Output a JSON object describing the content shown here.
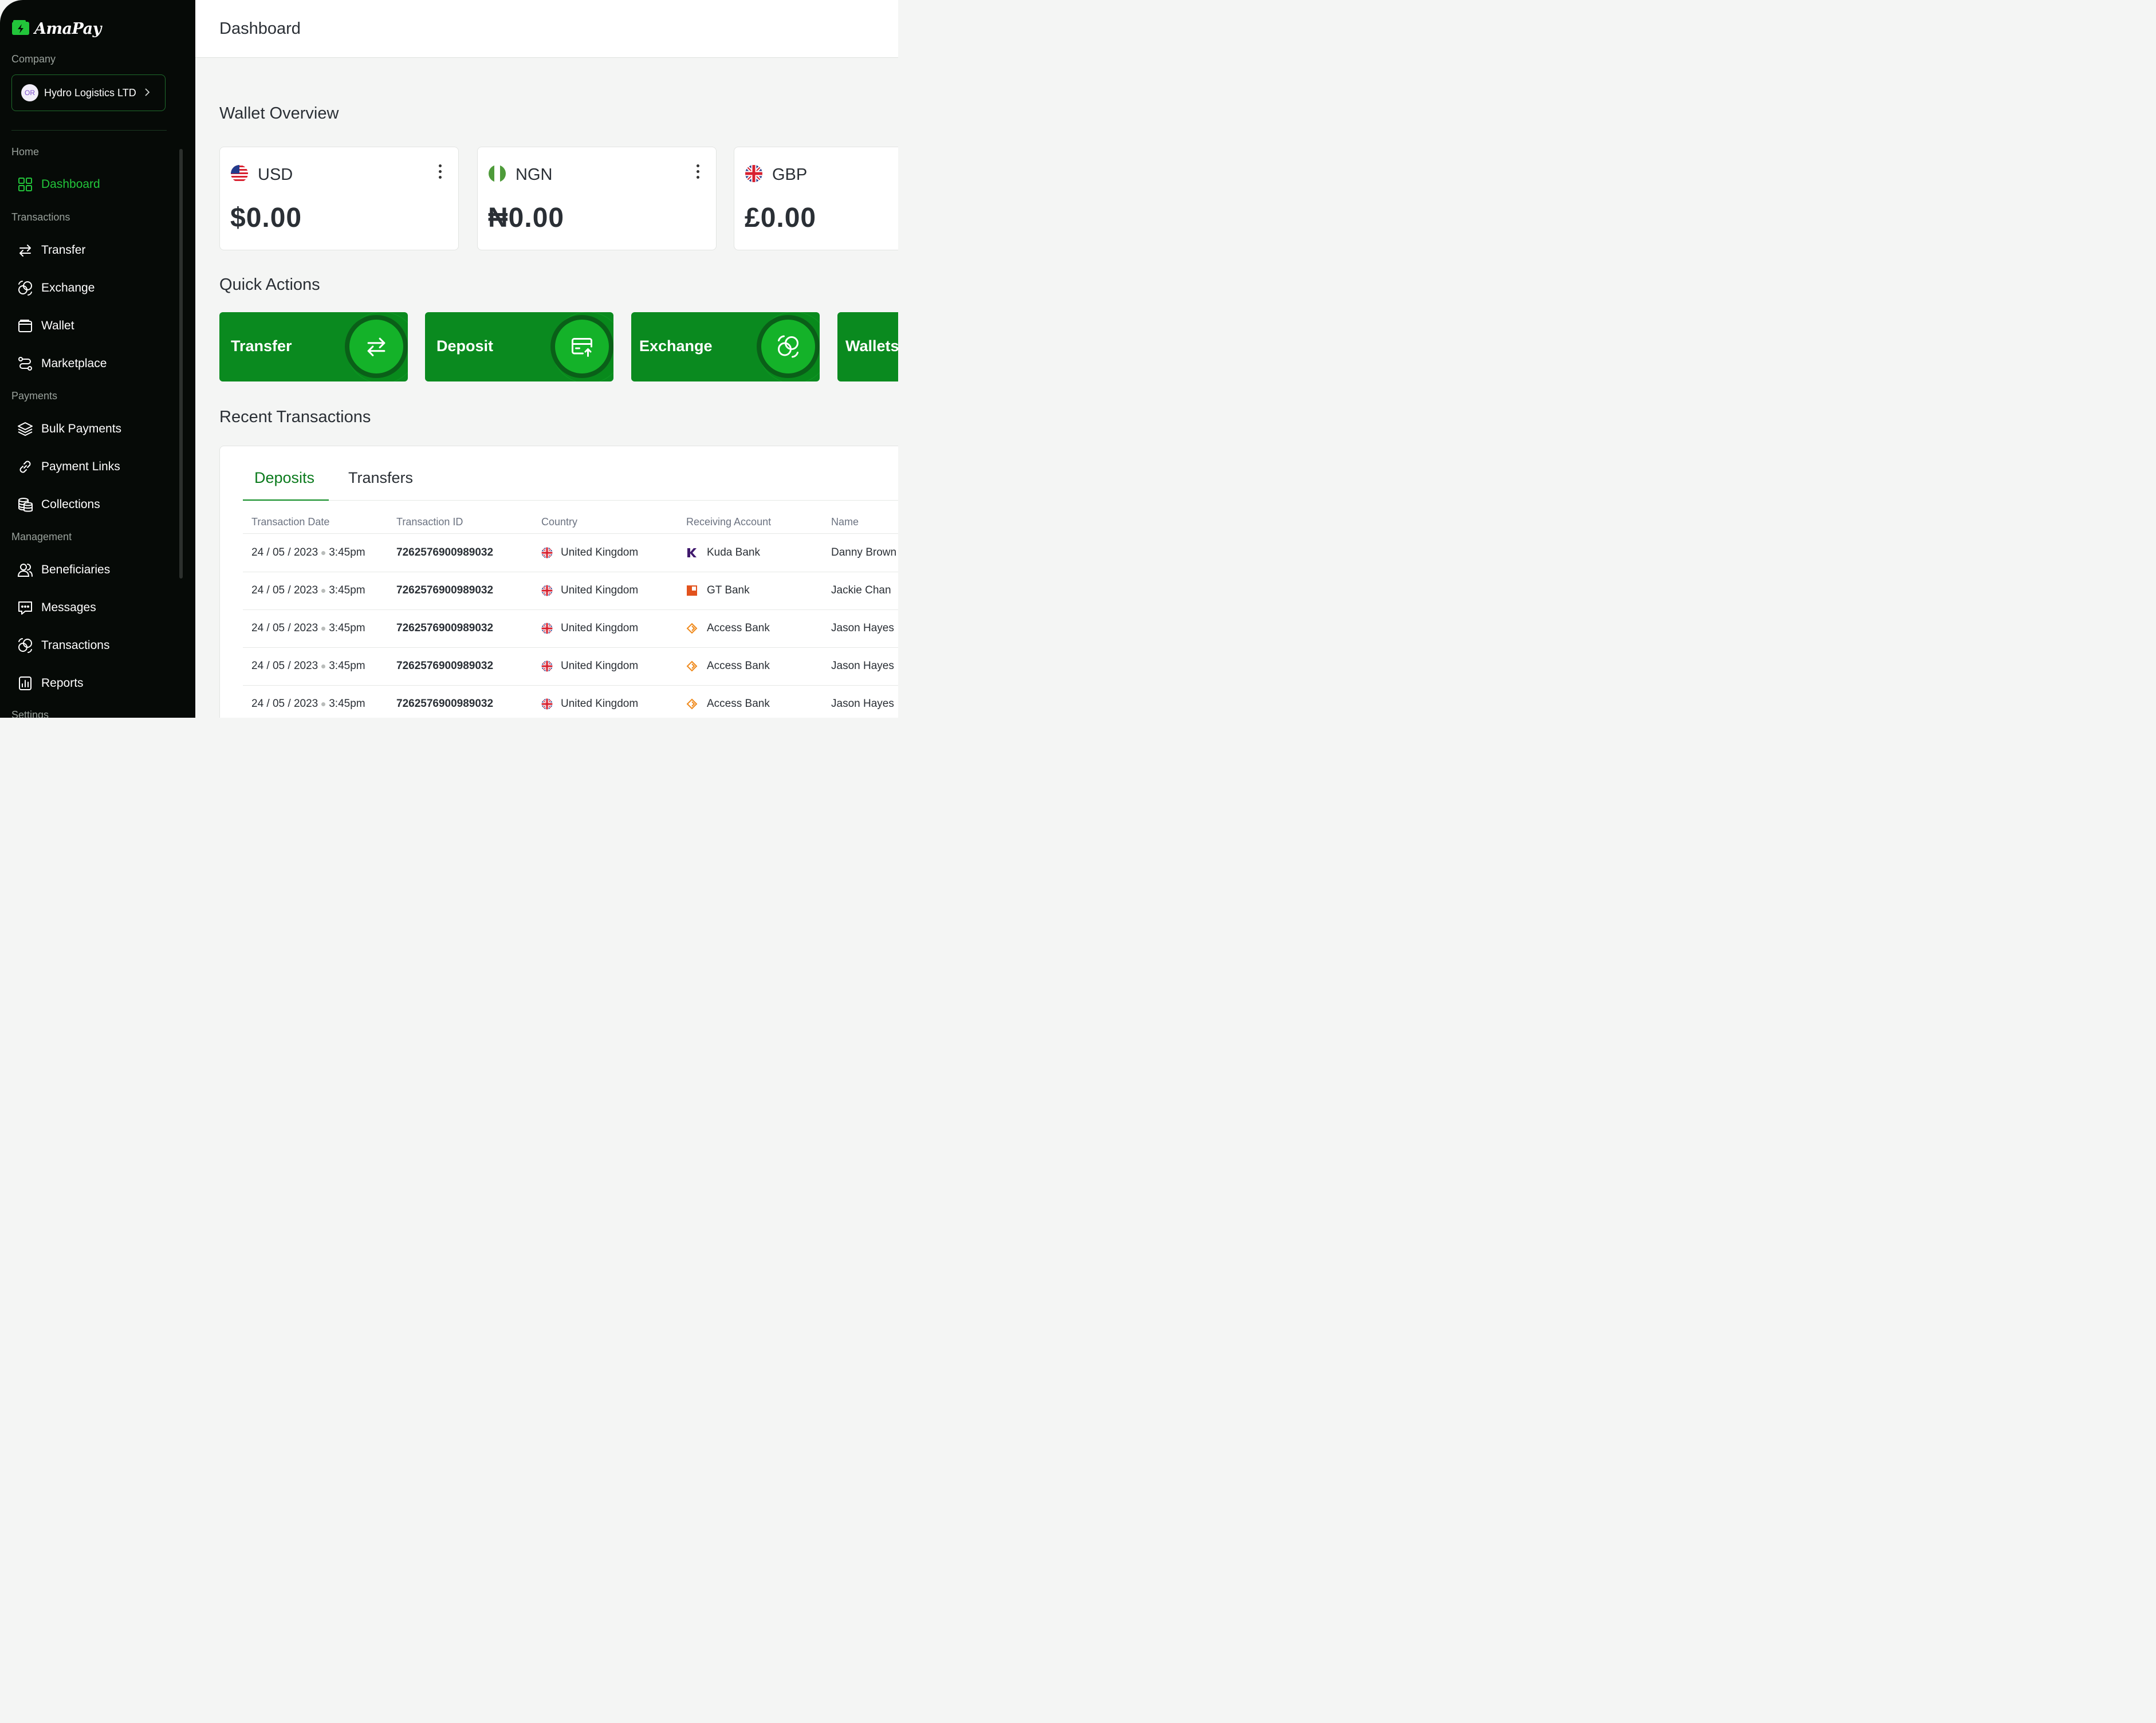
{
  "app": {
    "name": "AmaPay"
  },
  "sidebar": {
    "company_label": "Company",
    "company": {
      "initials": "OR",
      "name": "Hydro Logistics LTD"
    },
    "sections": [
      {
        "label": "Home"
      },
      {
        "label": "Transactions"
      },
      {
        "label": "Payments"
      },
      {
        "label": "Management"
      },
      {
        "label": "Settings"
      }
    ],
    "items": [
      {
        "label": "Dashboard",
        "icon": "grid-icon"
      },
      {
        "label": "Transfer",
        "icon": "arrows-swap-icon"
      },
      {
        "label": "Exchange",
        "icon": "exchange-icon"
      },
      {
        "label": "Wallet",
        "icon": "wallet-icon"
      },
      {
        "label": "Marketplace",
        "icon": "route-icon"
      },
      {
        "label": "Bulk Payments",
        "icon": "layers-icon"
      },
      {
        "label": "Payment Links",
        "icon": "link-icon"
      },
      {
        "label": "Collections",
        "icon": "coins-icon"
      },
      {
        "label": "Beneficiaries",
        "icon": "users-icon"
      },
      {
        "label": "Messages",
        "icon": "message-icon"
      },
      {
        "label": "Transactions",
        "icon": "exchange-icon"
      },
      {
        "label": "Reports",
        "icon": "report-icon"
      }
    ]
  },
  "header": {
    "title": "Dashboard"
  },
  "wallet_overview": {
    "title": "Wallet Overview",
    "wallets": [
      {
        "code": "USD",
        "amount": "$0.00",
        "flag": "us-flag-icon"
      },
      {
        "code": "NGN",
        "amount": "₦0.00",
        "flag": "ng-flag-icon"
      },
      {
        "code": "GBP",
        "amount": "£0.00",
        "flag": "uk-flag-icon"
      }
    ]
  },
  "quick_actions": {
    "title": "Quick Actions",
    "items": [
      {
        "label": "Transfer",
        "icon": "arrows-swap-icon"
      },
      {
        "label": "Deposit",
        "icon": "card-upload-icon"
      },
      {
        "label": "Exchange",
        "icon": "exchange-icon"
      },
      {
        "label": "Wallets",
        "icon": "wallet-icon"
      }
    ]
  },
  "recent_transactions": {
    "title": "Recent Transactions",
    "tabs": [
      "Deposits",
      "Transfers"
    ],
    "active_tab": "Deposits",
    "columns": [
      "Transaction Date",
      "Transaction ID",
      "Country",
      "Receiving Account",
      "Name"
    ],
    "rows": [
      {
        "date": "24 / 05 / 2023",
        "time": "3:45pm",
        "id": "7262576900989032",
        "country": "United Kingdom",
        "bank": "Kuda Bank",
        "bank_icon": "kuda-logo-icon",
        "name": "Danny Brown"
      },
      {
        "date": "24 / 05 / 2023",
        "time": "3:45pm",
        "id": "7262576900989032",
        "country": "United Kingdom",
        "bank": "GT Bank",
        "bank_icon": "gtbank-logo-icon",
        "name": "Jackie Chan"
      },
      {
        "date": "24 / 05 / 2023",
        "time": "3:45pm",
        "id": "7262576900989032",
        "country": "United Kingdom",
        "bank": "Access Bank",
        "bank_icon": "access-logo-icon",
        "name": "Jason Hayes"
      },
      {
        "date": "24 / 05 / 2023",
        "time": "3:45pm",
        "id": "7262576900989032",
        "country": "United Kingdom",
        "bank": "Access Bank",
        "bank_icon": "access-logo-icon",
        "name": "Jason Hayes"
      },
      {
        "date": "24 / 05 / 2023",
        "time": "3:45pm",
        "id": "7262576900989032",
        "country": "United Kingdom",
        "bank": "Access Bank",
        "bank_icon": "access-logo-icon",
        "name": "Jason Hayes"
      }
    ]
  },
  "colors": {
    "accent": "#0a8a1f",
    "active_nav": "#22c53a",
    "sidebar_bg": "#060a07"
  }
}
